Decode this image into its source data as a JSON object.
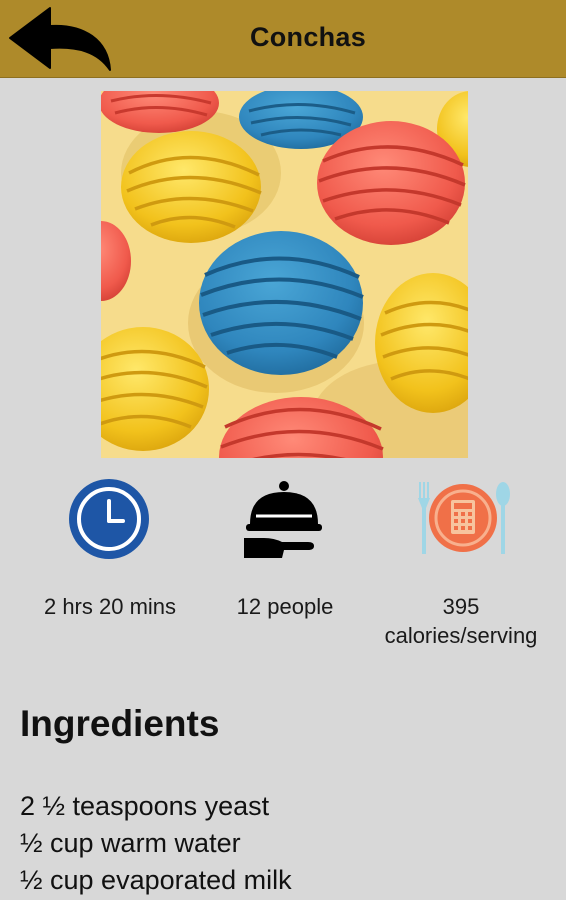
{
  "header": {
    "title": "Conchas",
    "back_icon": "back-arrow-icon",
    "color": "#ae8a2a"
  },
  "hero_image": {
    "description_icon": "conchas-photo",
    "background_color": "#f6dc8c"
  },
  "stats": [
    {
      "icon": "clock-icon",
      "label": "2 hrs 20 mins"
    },
    {
      "icon": "serving-cloche-icon",
      "label": "12 people"
    },
    {
      "icon": "calorie-calculator-icon",
      "label_line1": "395",
      "label_line2": "calories/serving"
    }
  ],
  "ingredients": {
    "title": "Ingredients",
    "items": [
      "2 ½ teaspoons yeast",
      "½ cup warm water",
      "½ cup evaporated milk"
    ]
  }
}
